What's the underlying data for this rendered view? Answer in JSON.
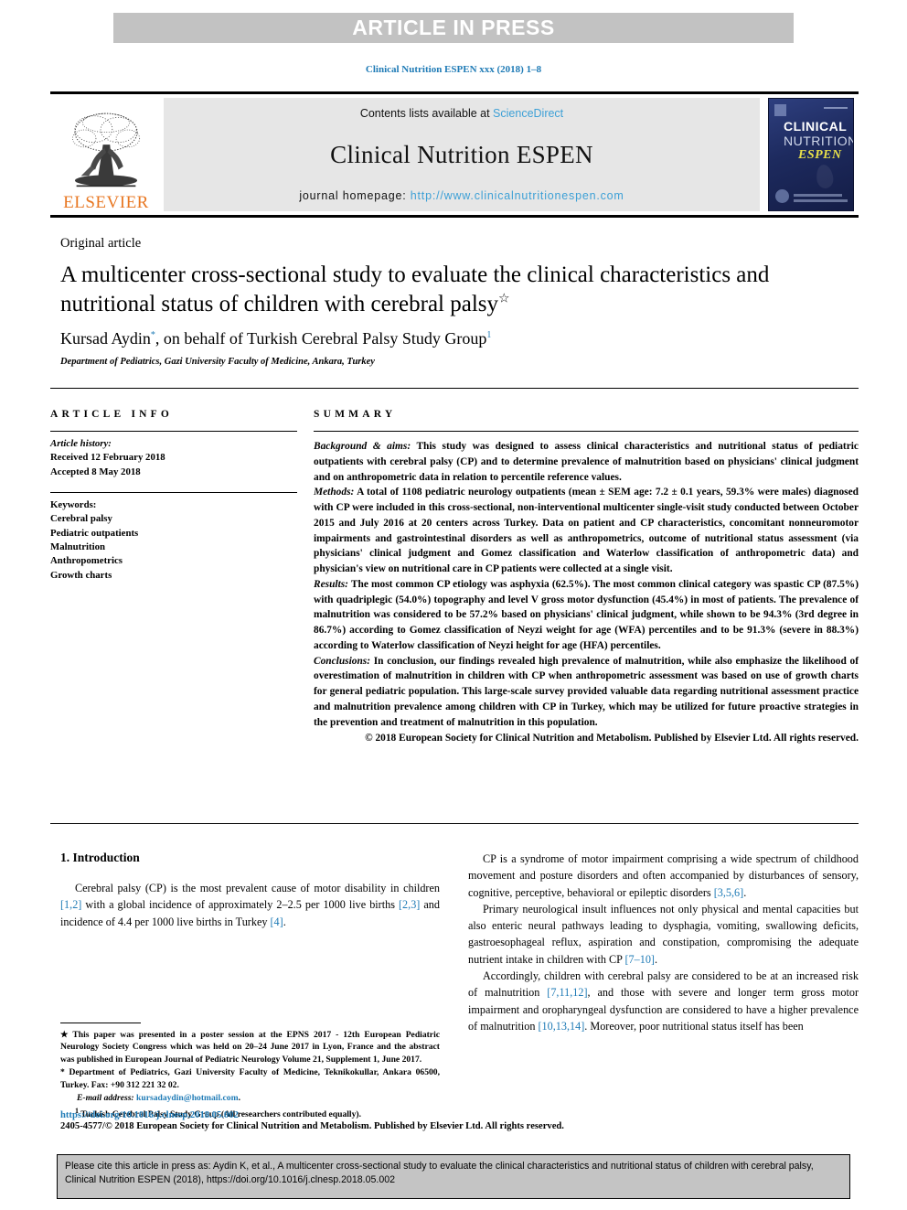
{
  "banner": {
    "text": "ARTICLE IN PRESS"
  },
  "running_citation": "Clinical Nutrition ESPEN xxx (2018) 1–8",
  "masthead": {
    "publisher_name": "ELSEVIER",
    "contents_prefix": "Contents lists available at ",
    "contents_link": "ScienceDirect",
    "journal_name": "Clinical Nutrition ESPEN",
    "homepage_label": "journal homepage: ",
    "homepage_url": "http://www.clinicalnutritionespen.com",
    "cover": {
      "line1": "CLINICAL",
      "line2": "NUTRITION",
      "line3": "ESPEN"
    }
  },
  "article": {
    "type": "Original article",
    "title": "A multicenter cross-sectional study to evaluate the clinical characteristics and nutritional status of children with cerebral palsy",
    "title_marker": "☆",
    "authors": "Kursad Aydin",
    "author_marker": "*",
    "authors_rest": ", on behalf of Turkish Cerebral Palsy Study Group",
    "authors_marker2": "1",
    "affiliation": "Department of Pediatrics, Gazi University Faculty of Medicine, Ankara, Turkey"
  },
  "article_info": {
    "heading": "ARTICLE INFO",
    "history_label": "Article history:",
    "received": "Received 12 February 2018",
    "accepted": "Accepted 8 May 2018",
    "keywords_label": "Keywords:",
    "keywords": [
      "Cerebral palsy",
      "Pediatric outpatients",
      "Malnutrition",
      "Anthropometrics",
      "Growth charts"
    ]
  },
  "summary": {
    "heading": "SUMMARY",
    "background_label": "Background & aims:",
    "background_text": " This study was designed to assess clinical characteristics and nutritional status of pediatric outpatients with cerebral palsy (CP) and to determine prevalence of malnutrition based on physicians' clinical judgment and on anthropometric data in relation to percentile reference values.",
    "methods_label": "Methods:",
    "methods_text": " A total of 1108 pediatric neurology outpatients (mean ± SEM age: 7.2 ± 0.1 years, 59.3% were males) diagnosed with CP were included in this cross-sectional, non-interventional multicenter single-visit study conducted between October 2015 and July 2016 at 20 centers across Turkey. Data on patient and CP characteristics, concomitant nonneuromotor impairments and gastrointestinal disorders as well as anthropometrics, outcome of nutritional status assessment (via physicians' clinical judgment and Gomez classification and Waterlow classification of anthropometric data) and physician's view on nutritional care in CP patients were collected at a single visit.",
    "results_label": "Results:",
    "results_text": " The most common CP etiology was asphyxia (62.5%). The most common clinical category was spastic CP (87.5%) with quadriplegic (54.0%) topography and level V gross motor dysfunction (45.4%) in most of patients. The prevalence of malnutrition was considered to be 57.2% based on physicians' clinical judgment, while shown to be 94.3% (3rd degree in 86.7%) according to Gomez classification of Neyzi weight for age (WFA) percentiles and to be 91.3% (severe in 88.3%) according to Waterlow classification of Neyzi height for age (HFA) percentiles.",
    "conclusions_label": "Conclusions:",
    "conclusions_text": " In conclusion, our findings revealed high prevalence of malnutrition, while also emphasize the likelihood of overestimation of malnutrition in children with CP when anthropometric assessment was based on use of growth charts for general pediatric population. This large-scale survey provided valuable data regarding nutritional assessment practice and malnutrition prevalence among children with CP in Turkey, which may be utilized for future proactive strategies in the prevention and treatment of malnutrition in this population.",
    "copyright": "© 2018 European Society for Clinical Nutrition and Metabolism. Published by Elsevier Ltd. All rights reserved."
  },
  "body": {
    "section_number_title": "1. Introduction",
    "left_paragraph_1_a": "Cerebral palsy (CP) is the most prevalent cause of motor disability in children ",
    "left_ref_1": "[1,2]",
    "left_paragraph_1_b": " with a global incidence of approximately 2–2.5 per 1000 live births ",
    "left_ref_2": "[2,3]",
    "left_paragraph_1_c": " and incidence of 4.4 per 1000 live births in Turkey ",
    "left_ref_3": "[4]",
    "left_paragraph_1_d": ".",
    "right_paragraph_1_a": "CP is a syndrome of motor impairment comprising a wide spectrum of childhood movement and posture disorders and often accompanied by disturbances of sensory, cognitive, perceptive, behavioral or epileptic disorders ",
    "right_ref_1": "[3,5,6]",
    "right_paragraph_1_b": ".",
    "right_paragraph_2_a": "Primary neurological insult influences not only physical and mental capacities but also enteric neural pathways leading to dysphagia, vomiting, swallowing deficits, gastroesophageal reflux, aspiration and constipation, compromising the adequate nutrient intake in children with CP ",
    "right_ref_2": "[7–10]",
    "right_paragraph_2_b": ".",
    "right_paragraph_3_a": "Accordingly, children with cerebral palsy are considered to be at an increased risk of malnutrition ",
    "right_ref_3": "[7,11,12]",
    "right_paragraph_3_b": ", and those with severe and longer term gross motor impairment and oropharyngeal dysfunction are considered to have a higher prevalence of malnutrition ",
    "right_ref_4": "[10,13,14]",
    "right_paragraph_3_c": ". Moreover, poor nutritional status itself has been"
  },
  "footnotes": {
    "star_mark": "★",
    "star_text": " This paper was presented in a poster session at the EPNS 2017 - 12th European Pediatric Neurology Society Congress which was held on 20–24 June 2017 in Lyon, France and the abstract was published in European Journal of Pediatric Neurology Volume 21, Supplement 1, June 2017.",
    "asterisk_mark": "*",
    "asterisk_text": " Department of Pediatrics, Gazi University Faculty of Medicine, Teknikokullar, Ankara 06500, Turkey. Fax: +90 312 221 32 02.",
    "email_label": "E-mail address:",
    "email": "kursadaydin@hotmail.com",
    "email_suffix": ".",
    "note1_mark": "1",
    "note1_text": " Turkish Cerebral Palsy Study Group (All researchers contributed equally)."
  },
  "footer": {
    "doi": "https://doi.org/10.1016/j.clnesp.2018.05.002",
    "issn_line": "2405-4577/© 2018 European Society for Clinical Nutrition and Metabolism. Published by Elsevier Ltd. All rights reserved."
  },
  "cite_box": {
    "text": "Please cite this article in press as: Aydin K, et al., A multicenter cross-sectional study to evaluate the clinical characteristics and nutritional status of children with cerebral palsy, Clinical Nutrition ESPEN (2018), https://doi.org/10.1016/j.clnesp.2018.05.002"
  },
  "colors": {
    "link": "#1f7bb6",
    "sciencedirect": "#3da0d6",
    "elsevier_orange": "#E87722",
    "banner_bg": "#c2c2c2",
    "journal_box_bg": "#e6e6e6",
    "cite_box_bg": "#c4c4c4"
  }
}
